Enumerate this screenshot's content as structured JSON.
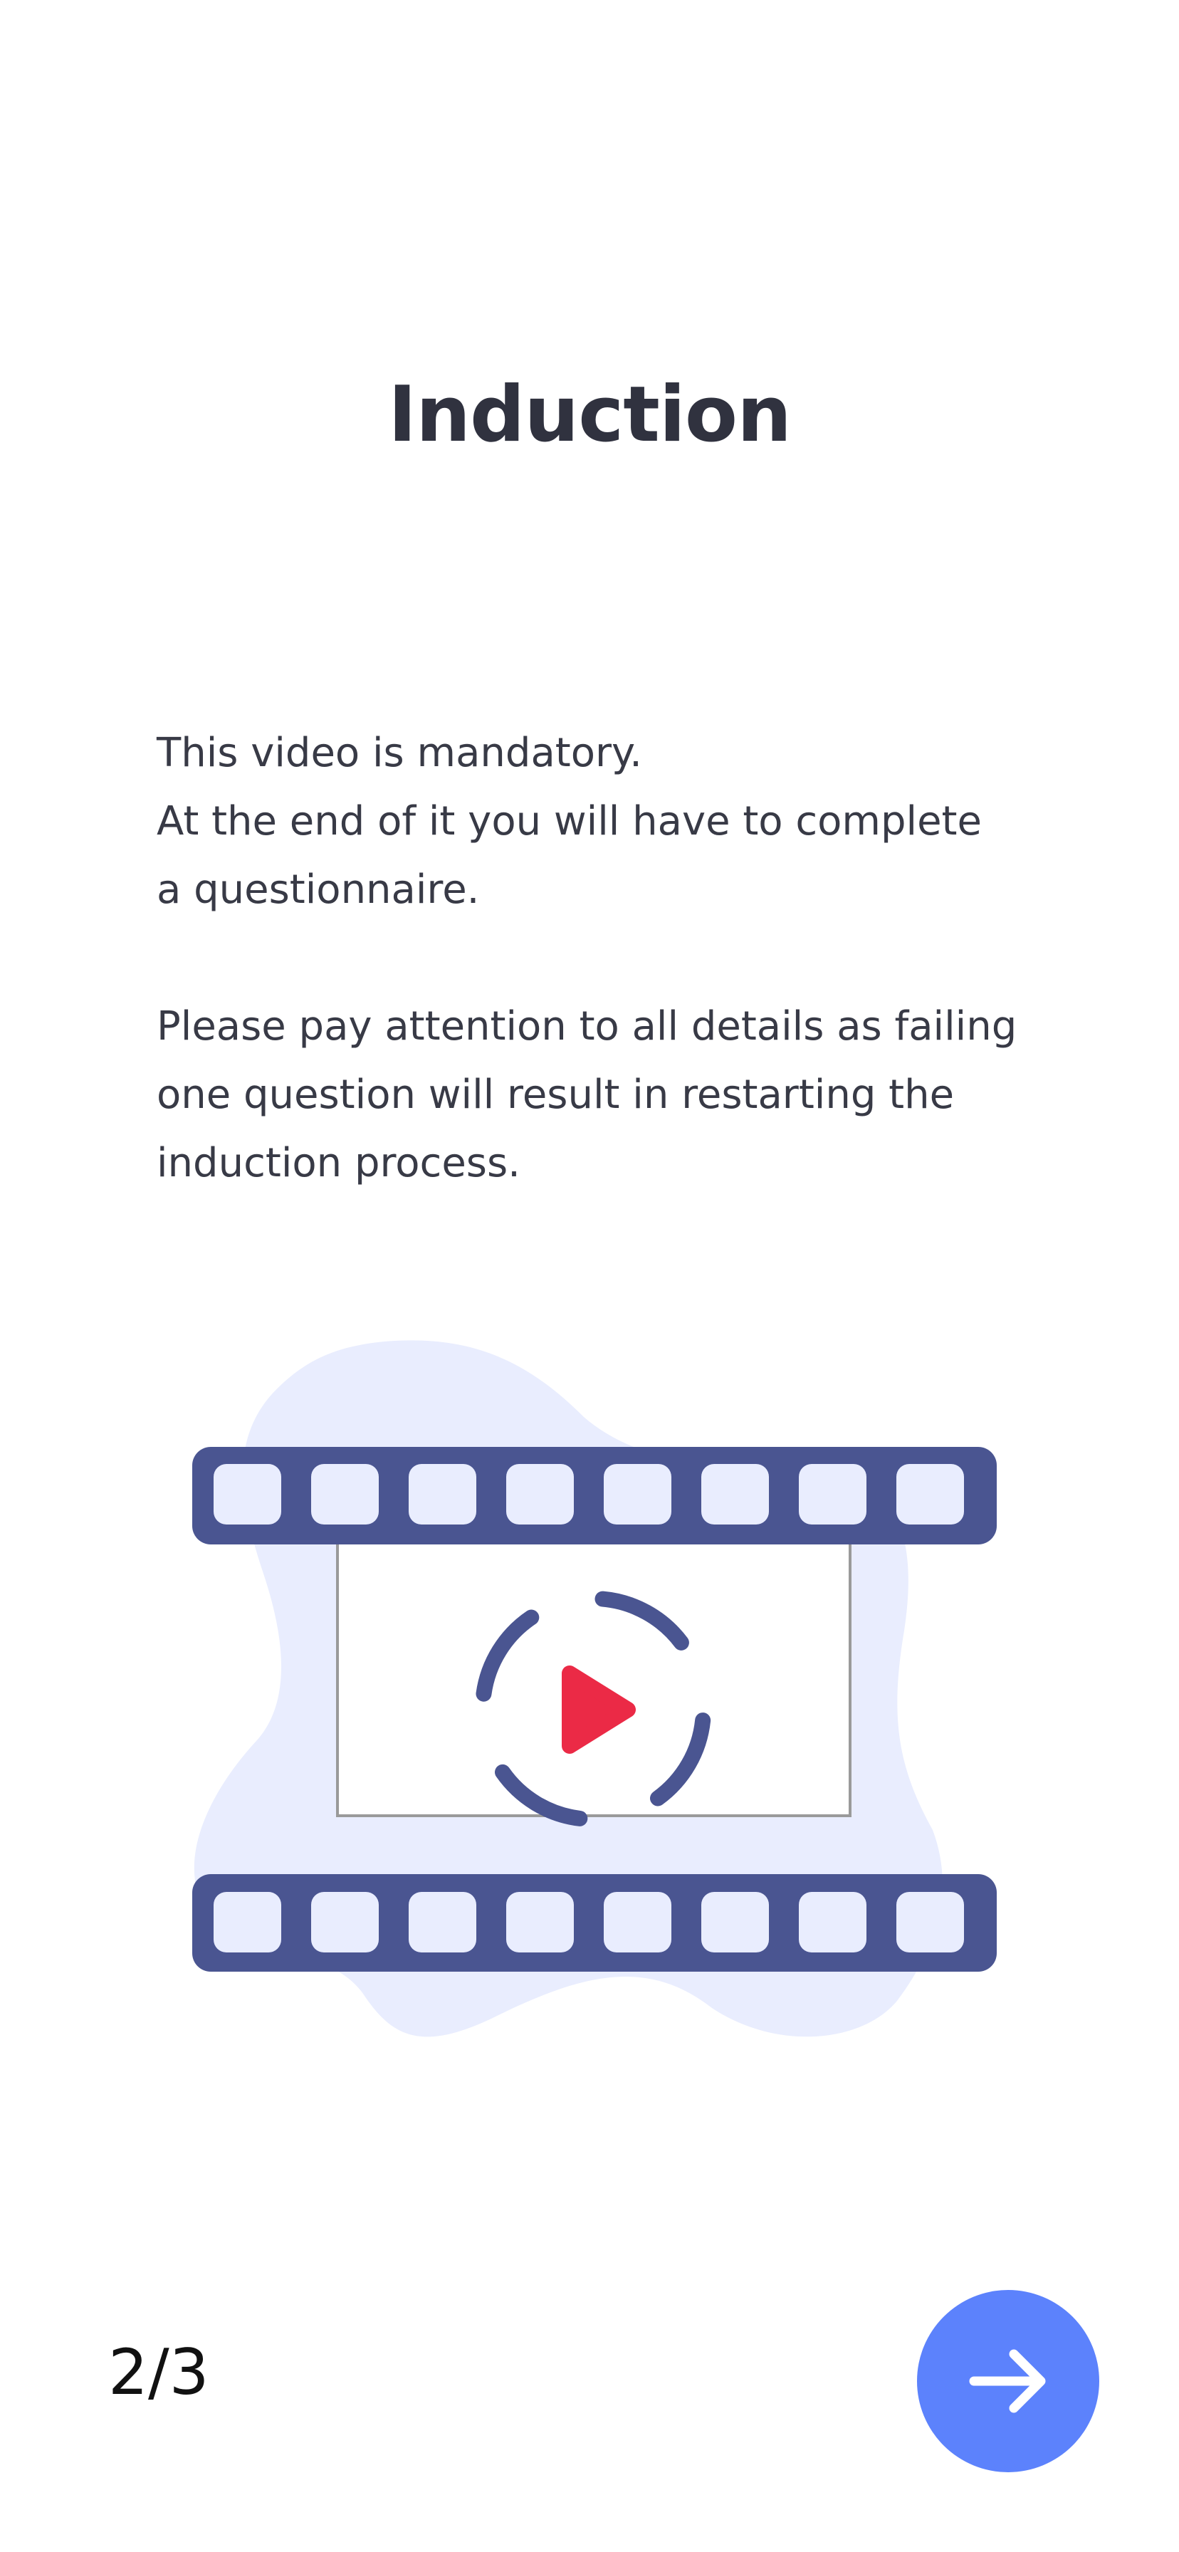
{
  "header": {
    "title": "Induction"
  },
  "content": {
    "paragraph1": [
      "This video is mandatory.",
      "At the end of it you will have to complete",
      "a questionnaire."
    ],
    "paragraph2": [
      "Please pay attention to all details as failing",
      "one question will result in restarting the",
      "induction process."
    ]
  },
  "illustration": {
    "icon": "video-play-icon",
    "colors": {
      "blob": "#e9edfe",
      "film": "#4a5591",
      "hole": "#e9edfe",
      "play": "#eb2a46"
    }
  },
  "footer": {
    "pager": "2/3",
    "next_icon": "arrow-right-icon",
    "next_color": "#5c82fc"
  }
}
